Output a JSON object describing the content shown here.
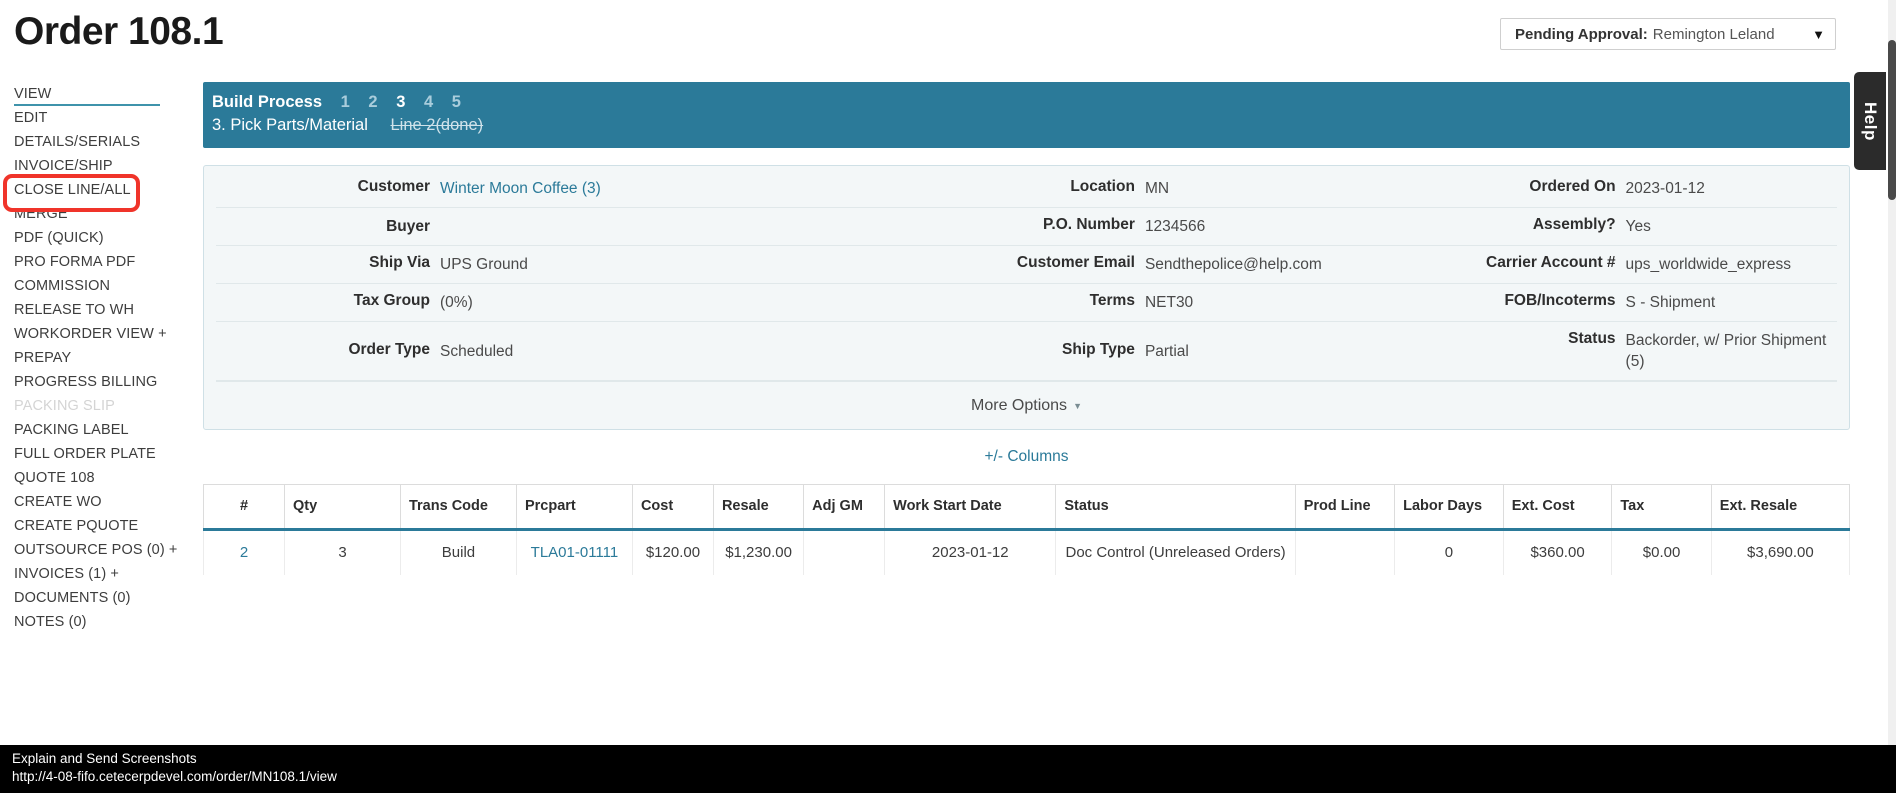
{
  "header": {
    "title": "Order 108.1",
    "approval": {
      "label": "Pending Approval:",
      "value": "Remington Leland",
      "caret": "▼"
    },
    "help_tab": "Help"
  },
  "sidebar": {
    "items": [
      {
        "label": "VIEW",
        "state": "active"
      },
      {
        "label": "EDIT",
        "state": "normal"
      },
      {
        "label": "DETAILS/SERIALS",
        "state": "normal"
      },
      {
        "label": "INVOICE/SHIP",
        "state": "normal"
      },
      {
        "label": "CLOSE LINE/ALL",
        "state": "highlighted"
      },
      {
        "label": "MERGE",
        "state": "normal"
      },
      {
        "label": "PDF (QUICK)",
        "state": "normal"
      },
      {
        "label": "PRO FORMA PDF",
        "state": "normal"
      },
      {
        "label": "COMMISSION",
        "state": "normal"
      },
      {
        "label": "RELEASE TO WH",
        "state": "normal"
      },
      {
        "label": "WORKORDER VIEW +",
        "state": "normal"
      },
      {
        "label": "PREPAY",
        "state": "normal"
      },
      {
        "label": "PROGRESS BILLING",
        "state": "normal"
      },
      {
        "label": "PACKING SLIP",
        "state": "disabled"
      },
      {
        "label": "PACKING LABEL",
        "state": "normal"
      },
      {
        "label": "FULL ORDER PLATE",
        "state": "normal"
      },
      {
        "label": "QUOTE 108",
        "state": "normal"
      },
      {
        "label": "CREATE WO",
        "state": "normal"
      },
      {
        "label": "CREATE PQUOTE",
        "state": "normal"
      },
      {
        "label": "OUTSOURCE POS (0) +",
        "state": "normal"
      },
      {
        "label": "INVOICES (1) +",
        "state": "normal"
      },
      {
        "label": "DOCUMENTS (0)",
        "state": "normal"
      },
      {
        "label": "NOTES (0)",
        "state": "normal"
      }
    ]
  },
  "build_process": {
    "title": "Build Process",
    "steps": [
      "1",
      "2",
      "3",
      "4",
      "5"
    ],
    "active_step": "3",
    "current_label": "3. Pick Parts/Material",
    "line_done": "Line 2(done)"
  },
  "details": {
    "rows": [
      {
        "c1_label": "Customer",
        "c1_value": "Winter Moon Coffee (3)",
        "c1_link": true,
        "c2_label": "Location",
        "c2_value": "MN",
        "c3_label": "Ordered On",
        "c3_value": "2023-01-12"
      },
      {
        "c1_label": "Buyer",
        "c1_value": "",
        "c2_label": "P.O. Number",
        "c2_value": "1234566",
        "c3_label": "Assembly?",
        "c3_value": "Yes"
      },
      {
        "c1_label": "Ship Via",
        "c1_value": "UPS Ground",
        "c2_label": "Customer Email",
        "c2_value": "Sendthepolice@help.com",
        "c3_label": "Carrier Account #",
        "c3_value": "ups_worldwide_express"
      },
      {
        "c1_label": "Tax Group",
        "c1_value": "(0%)",
        "c2_label": "Terms",
        "c2_value": "NET30",
        "c3_label": "FOB/Incoterms",
        "c3_value": "S - Shipment"
      },
      {
        "c1_label": "Order Type",
        "c1_value": "Scheduled",
        "c2_label": "Ship Type",
        "c2_value": "Partial",
        "c3_label": "Status",
        "c3_value": "Backorder, w/ Prior Shipment (5)"
      }
    ],
    "more_options": "More Options",
    "more_options_caret": "▼"
  },
  "table": {
    "columns_link": "+/- Columns",
    "headers": [
      "#",
      "Qty",
      "Trans Code",
      "Prcpart",
      "Cost",
      "Resale",
      "Adj GM",
      "Work Start Date",
      "Status",
      "Prod Line",
      "Labor Days",
      "Ext. Cost",
      "Tax",
      "Ext. Resale"
    ],
    "rows": [
      {
        "num": "2",
        "qty": "3",
        "trans_code": "Build",
        "prcpart": "TLA01-01111",
        "cost": "$120.00",
        "resale": "$1,230.00",
        "adj_gm": "",
        "work_start_date": "2023-01-12",
        "status": "Doc Control (Unreleased Orders)",
        "prod_line": "",
        "labor_days": "0",
        "ext_cost": "$360.00",
        "tax": "$0.00",
        "ext_resale": "$3,690.00"
      }
    ]
  },
  "status_bar": {
    "title": "Explain and Send Screenshots",
    "url": "http://4-08-fifo.cetecerpdevel.com/order/MN108.1/view"
  },
  "colors": {
    "accent_teal": "#2b7a99",
    "link": "#2b7a99",
    "highlight_red": "#f0342a",
    "panel_bg": "#f3f7f8"
  }
}
